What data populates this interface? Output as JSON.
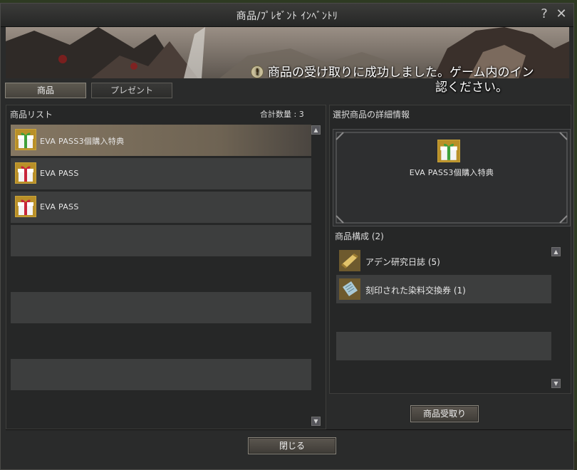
{
  "window": {
    "title": "商品/ﾌﾟﾚｾﾞﾝﾄ ｲﾝﾍﾞﾝﾄﾘ",
    "help_label": "?",
    "close_label": "✕"
  },
  "notice": {
    "line1": "商品の受け取りに成功しました。ゲーム内のイン",
    "line2": "認ください。",
    "icon": "exclamation-icon"
  },
  "tabs": [
    {
      "label": "商品",
      "active": true
    },
    {
      "label": "プレゼント",
      "active": false
    }
  ],
  "product_list": {
    "header": "商品リスト",
    "count_label": "合計数量 : 3",
    "items": [
      {
        "name": "EVA PASS3個購入特典",
        "icon": "green-gift-icon",
        "selected": true
      },
      {
        "name": "EVA PASS",
        "icon": "red-gift-icon",
        "selected": false
      },
      {
        "name": "EVA PASS",
        "icon": "red-gift-icon",
        "selected": false
      }
    ]
  },
  "detail": {
    "header": "選択商品の詳細情報",
    "item_name": "EVA PASS3個購入特典",
    "item_icon": "green-gift-icon",
    "composition_header": "商品構成 (2)",
    "components": [
      {
        "name": "アデン研究日誌 (5)",
        "icon": "scroll-icon"
      },
      {
        "name": "刻印された染料交換券 (1)",
        "icon": "ticket-icon"
      }
    ],
    "receive_button": "商品受取り"
  },
  "footer": {
    "close_button": "閉じる"
  },
  "colors": {
    "selected_row": "#857762",
    "row": "#3d3e3e",
    "panel": "#262727",
    "gift_green_ribbon": "#3fa03a",
    "gift_red_ribbon": "#c8253a"
  }
}
